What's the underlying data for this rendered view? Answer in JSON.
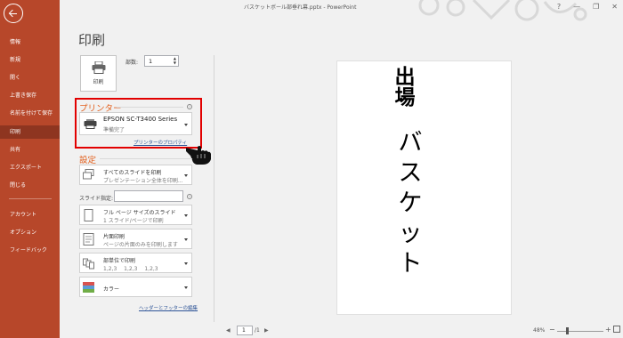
{
  "window": {
    "title": "バスケットボール部垂れ幕.pptx - PowerPoint",
    "minimize": "—",
    "restore": "❐",
    "close": "✕"
  },
  "nav": {
    "items": [
      {
        "label": "情報"
      },
      {
        "label": "新規"
      },
      {
        "label": "開く"
      },
      {
        "label": "上書き保存"
      },
      {
        "label": "名前を付けて保存"
      },
      {
        "label": "印刷",
        "active": true
      },
      {
        "label": "共有"
      },
      {
        "label": "エクスポート"
      },
      {
        "label": "閉じる"
      },
      {
        "label": "アカウント"
      },
      {
        "label": "オプション"
      },
      {
        "label": "フィードバック"
      }
    ]
  },
  "page_title": "印刷",
  "print_button": {
    "label": "印刷"
  },
  "copies": {
    "label": "部数:",
    "value": "1"
  },
  "printer": {
    "heading": "プリンター",
    "name": "EPSON SC-T3400 Series",
    "status": "準備完了",
    "properties_link": "プリンターのプロパティ"
  },
  "settings": {
    "heading": "設定",
    "slides_label": "スライド指定:",
    "slides_value": "",
    "options": [
      {
        "line1": "すべてのスライドを印刷",
        "line2": "プレゼンテーション全体を印刷..."
      },
      {
        "line1": "フル ページ サイズのスライド",
        "line2": "1 スライド/ページで印刷"
      },
      {
        "line1": "片面印刷",
        "line2": "ページの片面のみを印刷します"
      },
      {
        "line1": "部単位で印刷",
        "line2": "1,2,3　 1,2,3　 1,2,3"
      },
      {
        "line1": "カラー",
        "line2": ""
      }
    ],
    "header_footer_link": "ヘッダーとフッターの編集"
  },
  "preview": {
    "line1": "出場",
    "line2": "バスケット"
  },
  "bottom": {
    "prev": "◀",
    "page": "1",
    "total": "/1",
    "next": "▶",
    "zoom": "48%",
    "zoom_minus": "−",
    "zoom_plus": "+"
  },
  "colors": {
    "nav_bg": "#b7472a",
    "nav_active": "#8e3520",
    "heading": "#e2601e",
    "highlight": "#e20000",
    "link": "#2f5597"
  },
  "icons": [
    "back-arrow-icon",
    "printer-icon",
    "slides-icon",
    "page-icon",
    "one-sided-icon",
    "collate-icon",
    "color-icon",
    "hand-pointer-icon",
    "info-icon"
  ]
}
